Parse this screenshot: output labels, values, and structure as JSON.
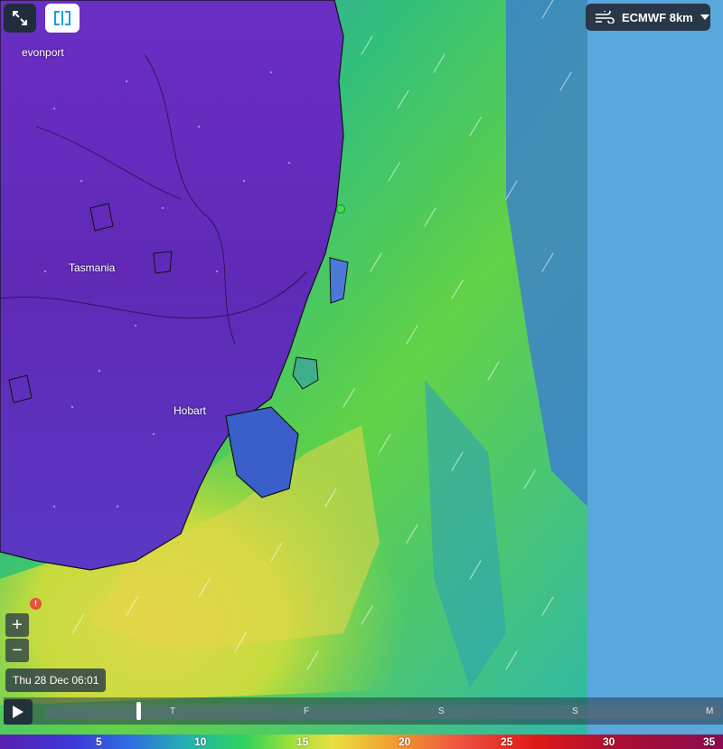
{
  "map": {
    "places": {
      "devonport": "evonport",
      "tasmania": "Tasmania",
      "hobart": "Hobart"
    }
  },
  "model": {
    "label": "ECMWF 8km",
    "icon": "wind-icon"
  },
  "controls": {
    "expand_icon": "expand-icon",
    "split_icon": "split-view-icon",
    "zoom_in": "+",
    "zoom_out": "−",
    "alert": "!"
  },
  "timeline": {
    "current_time": "Thu 28 Dec 06:01",
    "days": [
      "T",
      "F",
      "S",
      "S",
      "M"
    ]
  },
  "legend": {
    "labels": [
      "5",
      "10",
      "15",
      "20",
      "25",
      "30",
      "35"
    ]
  },
  "colors": {
    "land_purple": "#5e2eb2",
    "sea_green": "#3fcf7a",
    "sea_yellow": "#c8de3c",
    "ocean_blue": "#5aa7dc",
    "control_dark": "#283848"
  }
}
